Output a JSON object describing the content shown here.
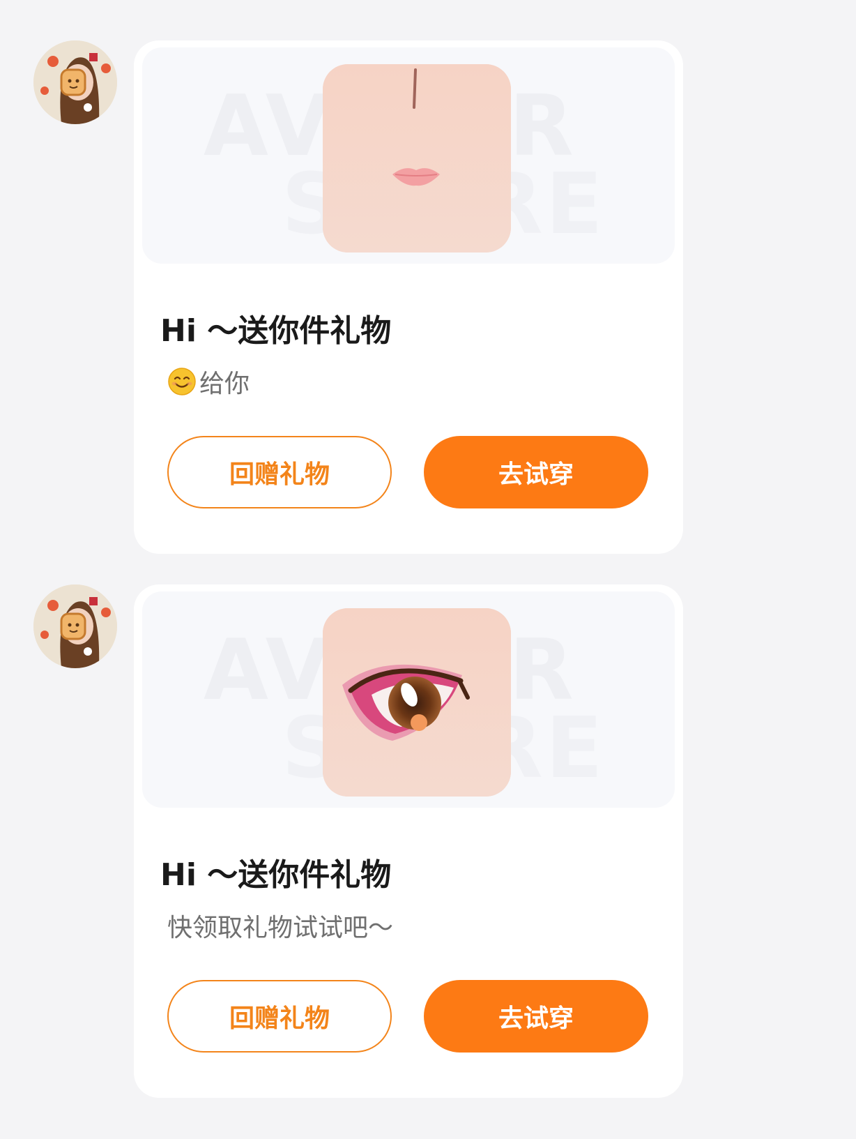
{
  "messages": [
    {
      "title": "Hi ～送你件礼物",
      "subtitle": "给你",
      "preview_icon": "face-nose-lips",
      "watermark_lines": [
        "AVATAR",
        "STORE"
      ],
      "return_gift_label": "回赠礼物",
      "try_on_label": "去试穿"
    },
    {
      "title": "Hi ～送你件礼物",
      "subtitle": "快领取礼物试试吧～",
      "preview_icon": "eye",
      "watermark_lines": [
        "AVATAR",
        "STORE"
      ],
      "return_gift_label": "回赠礼物",
      "try_on_label": "去试穿"
    }
  ],
  "colors": {
    "accent": "#fd7a14",
    "accent_outline": "#f3841a",
    "background": "#f4f4f6",
    "card": "#ffffff"
  }
}
